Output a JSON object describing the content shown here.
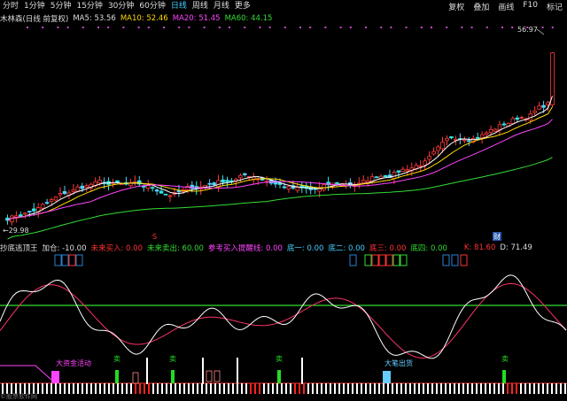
{
  "toolbar": {
    "timeframes": [
      "分时",
      "1分钟",
      "5分钟",
      "15分钟",
      "30分钟",
      "60分钟",
      "日线",
      "周线",
      "月线",
      "更多"
    ],
    "active_timeframe": "日线",
    "right_buttons": [
      "复权",
      "叠加",
      "画线",
      "F10",
      "标记"
    ]
  },
  "main_info": {
    "title": "木林森(日线 前复权)",
    "ma5": "MA5: 53.56",
    "ma10": "MA10: 52.46",
    "ma20": "MA20: 51.45",
    "ma60": "MA60: 44.15"
  },
  "price_labels": {
    "high": "56.97",
    "low": "29.98"
  },
  "markers": {
    "red_s": "S",
    "cai": "财"
  },
  "indicator_info": {
    "name": "抄底逃顶王",
    "v1": "加仓: -10.00",
    "v2": "未来买入: 0.00",
    "v3": "未来卖出: 60.00",
    "v4": "参考买入提醒线: 0.00",
    "v5": "底一: 0.00",
    "v6": "底二: 0.00",
    "v7": "底三: 0.00",
    "v8": "底四: 0.00",
    "k": "K: 81.60",
    "d": "D: 71.49"
  },
  "indicator_labels": {
    "big_fund": "大资金活动",
    "sell": "卖",
    "big_ship": "大笔出货"
  },
  "footer": "©股票软件网"
}
